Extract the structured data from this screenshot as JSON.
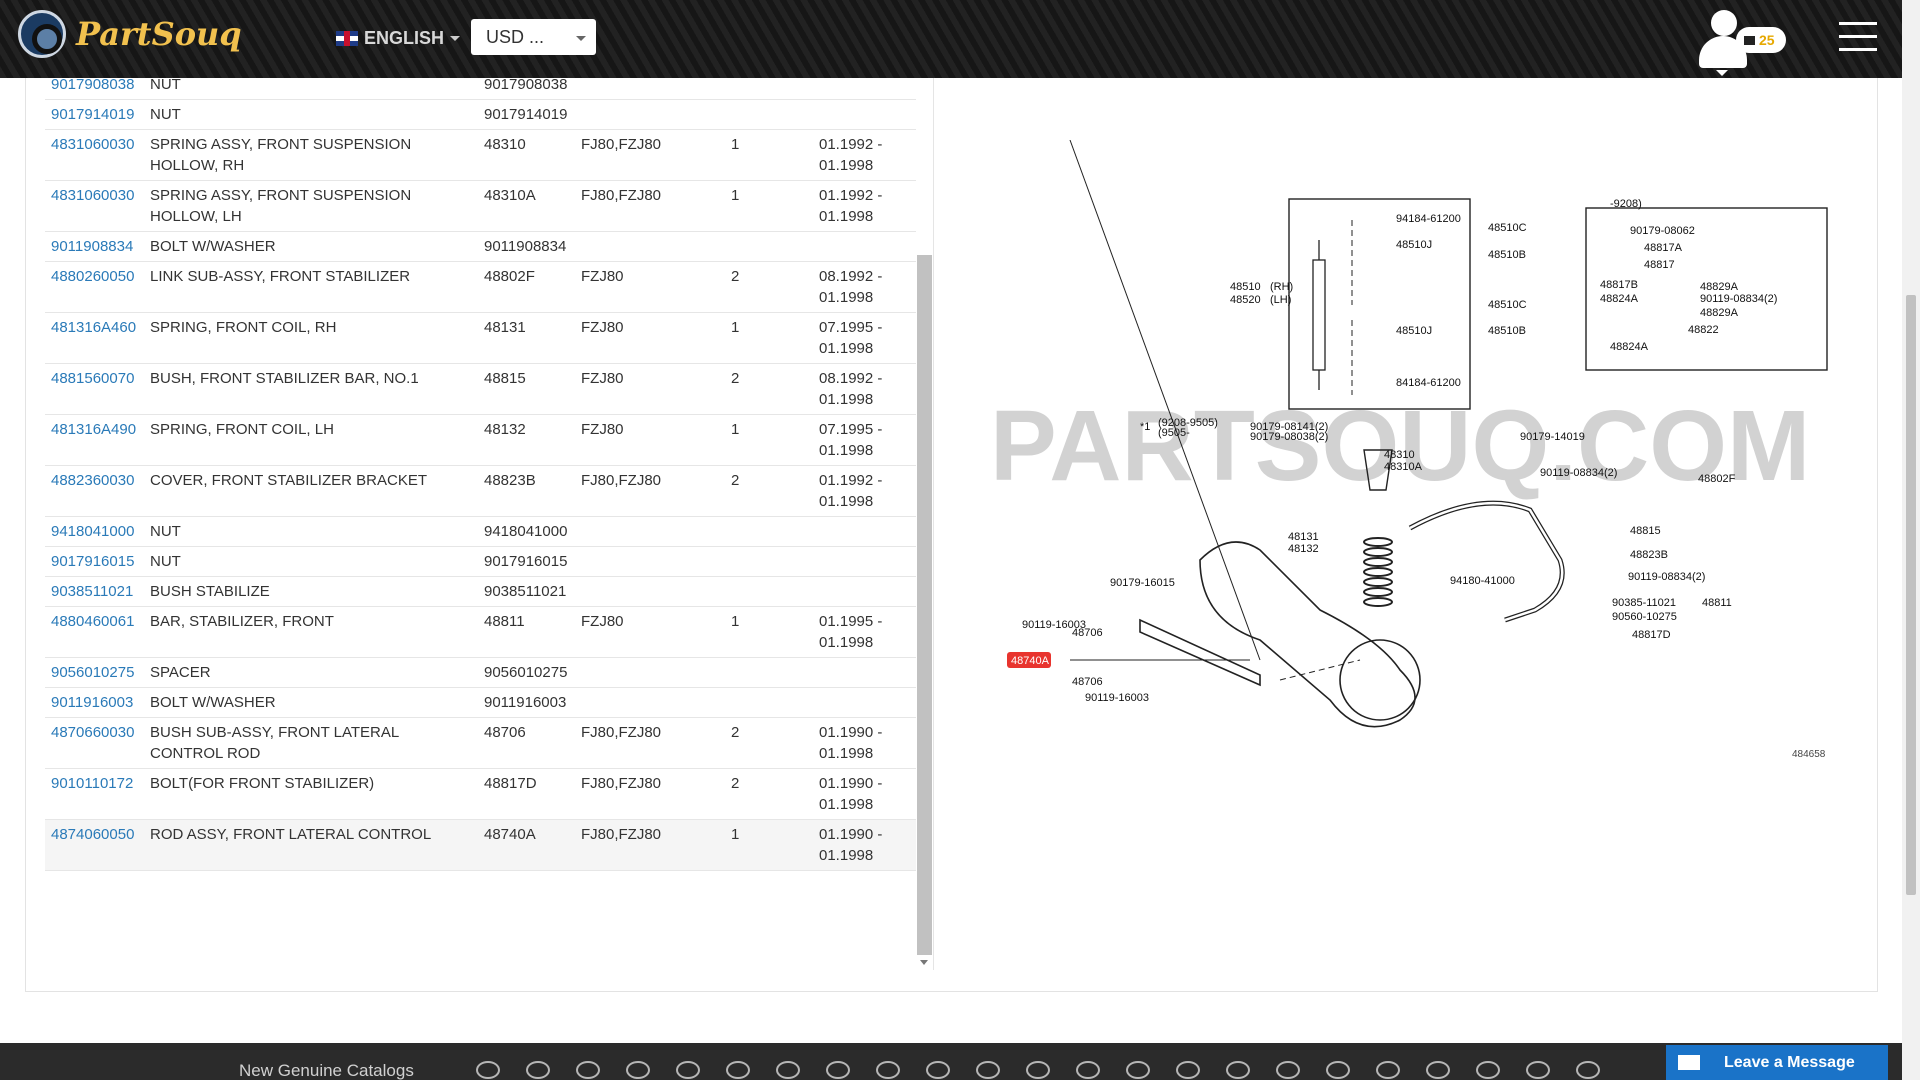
{
  "header": {
    "logo_text": "PartSouq",
    "language": "ENGLISH",
    "currency": "USD ...",
    "cart_count": "25"
  },
  "parts": [
    {
      "number": "9017908038",
      "name": "NUT",
      "code": "9017908038",
      "model": "",
      "qty": "",
      "date1": "",
      "date2": ""
    },
    {
      "number": "9017914019",
      "name": "NUT",
      "code": "9017914019",
      "model": "",
      "qty": "",
      "date1": "",
      "date2": ""
    },
    {
      "number": "4831060030",
      "name": "SPRING ASSY, FRONT SUSPENSION HOLLOW, RH",
      "code": "48310",
      "model": "FJ80,FZJ80",
      "qty": "1",
      "date1": "01.1992 -",
      "date2": "01.1998"
    },
    {
      "number": "4831060030",
      "name": "SPRING ASSY, FRONT SUSPENSION HOLLOW, LH",
      "code": "48310A",
      "model": "FJ80,FZJ80",
      "qty": "1",
      "date1": "01.1992 -",
      "date2": "01.1998"
    },
    {
      "number": "9011908834",
      "name": "BOLT W/WASHER",
      "code": "9011908834",
      "model": "",
      "qty": "",
      "date1": "",
      "date2": ""
    },
    {
      "number": "4880260050",
      "name": "LINK SUB-ASSY, FRONT STABILIZER",
      "code": "48802F",
      "model": "FZJ80",
      "qty": "2",
      "date1": "08.1992 -",
      "date2": "01.1998"
    },
    {
      "number": "481316A460",
      "name": "SPRING, FRONT COIL, RH",
      "code": "48131",
      "model": "FZJ80",
      "qty": "1",
      "date1": "07.1995 -",
      "date2": "01.1998"
    },
    {
      "number": "4881560070",
      "name": "BUSH, FRONT STABILIZER BAR, NO.1",
      "code": "48815",
      "model": "FZJ80",
      "qty": "2",
      "date1": "08.1992 -",
      "date2": "01.1998"
    },
    {
      "number": "481316A490",
      "name": "SPRING, FRONT COIL, LH",
      "code": "48132",
      "model": "FZJ80",
      "qty": "1",
      "date1": "07.1995 -",
      "date2": "01.1998"
    },
    {
      "number": "4882360030",
      "name": "COVER, FRONT STABILIZER BRACKET",
      "code": "48823B",
      "model": "FJ80,FZJ80",
      "qty": "2",
      "date1": "01.1992 -",
      "date2": "01.1998"
    },
    {
      "number": "9418041000",
      "name": "NUT",
      "code": "9418041000",
      "model": "",
      "qty": "",
      "date1": "",
      "date2": ""
    },
    {
      "number": "9017916015",
      "name": "NUT",
      "code": "9017916015",
      "model": "",
      "qty": "",
      "date1": "",
      "date2": ""
    },
    {
      "number": "9038511021",
      "name": "BUSH STABILIZE",
      "code": "9038511021",
      "model": "",
      "qty": "",
      "date1": "",
      "date2": ""
    },
    {
      "number": "4880460061",
      "name": "BAR, STABILIZER, FRONT",
      "code": "48811",
      "model": "FZJ80",
      "qty": "1",
      "date1": "01.1995 -",
      "date2": "01.1998"
    },
    {
      "number": "9056010275",
      "name": "SPACER",
      "code": "9056010275",
      "model": "",
      "qty": "",
      "date1": "",
      "date2": ""
    },
    {
      "number": "9011916003",
      "name": "BOLT W/WASHER",
      "code": "9011916003",
      "model": "",
      "qty": "",
      "date1": "",
      "date2": ""
    },
    {
      "number": "4870660030",
      "name": "BUSH SUB-ASSY, FRONT LATERAL CONTROL ROD",
      "code": "48706",
      "model": "FJ80,FZJ80",
      "qty": "2",
      "date1": "01.1990 -",
      "date2": "01.1998"
    },
    {
      "number": "9010110172",
      "name": "BOLT(FOR FRONT STABILIZER)",
      "code": "48817D",
      "model": "FJ80,FZJ80",
      "qty": "2",
      "date1": "01.1990 -",
      "date2": "01.1998"
    },
    {
      "number": "4874060050",
      "name": "ROD ASSY, FRONT LATERAL CONTROL",
      "code": "48740A",
      "model": "FJ80,FZJ80",
      "qty": "1",
      "date1": "01.1990 -",
      "date2": "01.1998"
    }
  ],
  "diagram": {
    "watermark": "PARTSOUQ.COM",
    "diagram_id": "484658",
    "highlight_label": "48740A",
    "highlight_color": "#e8342e",
    "labels": [
      "94184-61200",
      "48510C",
      "48510J",
      "48510B",
      "48510",
      "48520",
      "(RH)",
      "(LH)",
      "48510J",
      "48510C",
      "48510B",
      "84184-61200",
      "-9208)",
      "90179-08062",
      "48817A",
      "48817",
      "48817B",
      "48824A",
      "48829A",
      "90119-08834(2)",
      "48822",
      "48824A",
      "48829A",
      "*1",
      "(9208-9505)",
      "(9505-",
      "90179-08141(2)",
      "90179-08038(2)",
      "48310",
      "48310A",
      "90179-14019",
      "90119-08834(2)",
      "48802F",
      "48131",
      "48132",
      "48815",
      "48823B",
      "90119-08834(2)",
      "94180-41000",
      "90179-16015",
      "90385-11021",
      "48811",
      "90560-10275",
      "48817D",
      "90119-16003",
      "48706",
      "48706",
      "90119-16003"
    ]
  },
  "footer": {
    "catalogs_title": "New Genuine Catalogs",
    "chat_label": "Leave a Message"
  },
  "colors": {
    "link": "#2a7ab8",
    "header_bg": "#1a1a1a",
    "chat_bg": "#1a73c8",
    "logo": "#f2c14e"
  }
}
